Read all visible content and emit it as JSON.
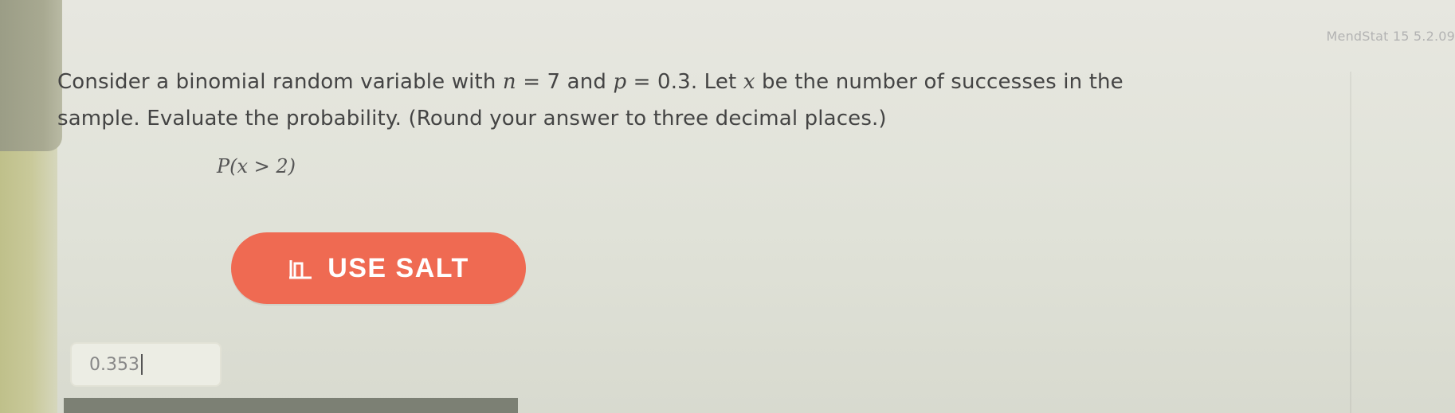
{
  "problem_ref": "MendStat 15 5.2.09",
  "question": {
    "line1_a": "Consider a binomial random variable with ",
    "n_var": "n",
    "n_eq": " = 7 and ",
    "p_var": "p",
    "p_eq": " = 0.3. Let ",
    "x_var": "x",
    "line1_b": " be the number of successes in the",
    "line2": "sample. Evaluate the probability. (Round your answer to three decimal places.)"
  },
  "probability_expression": "P(x > 2)",
  "salt_button": {
    "label": "USE SALT",
    "icon": "salt-chart-icon",
    "color": "#ef6a52"
  },
  "answer": {
    "value": "0.353"
  }
}
